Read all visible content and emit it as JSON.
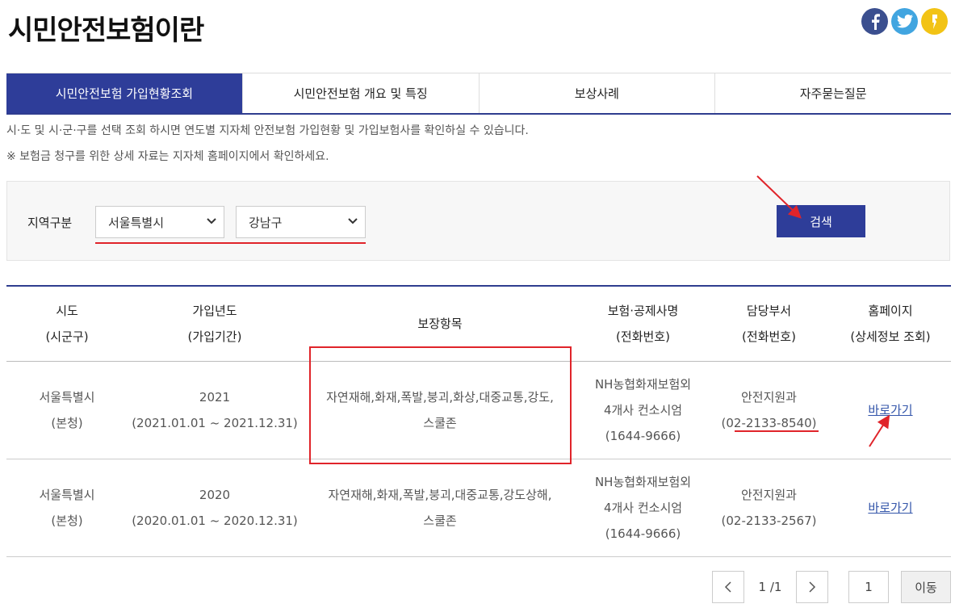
{
  "page": {
    "title": "시민안전보험이란"
  },
  "sns": [
    {
      "name": "facebook",
      "glyph": "f",
      "color": "#3b4f8f"
    },
    {
      "name": "twitter",
      "glyph": "t",
      "color": "#41a5e0"
    },
    {
      "name": "kakaostory",
      "glyph": "s",
      "color": "#f2c315"
    }
  ],
  "tabs": [
    {
      "label": "시민안전보험 가입현황조회",
      "active": true
    },
    {
      "label": "시민안전보험 개요 및 특징"
    },
    {
      "label": "보상사례"
    },
    {
      "label": "자주묻는질문"
    }
  ],
  "notices": [
    "시·도 및 시·군·구를 선택 조회 하시면 연도별 지자체 안전보험 가입현황 및 가입보험사를 확인하실 수 있습니다.",
    "※ 보험금 청구를 위한 상세 자료는 지자체 홈페이지에서 확인하세요."
  ],
  "search": {
    "label": "지역구분",
    "sido": "서울특별시",
    "sigungu": "강남구",
    "button": "검색"
  },
  "table": {
    "headers": [
      [
        "시도",
        "(시군구)"
      ],
      [
        "가입년도",
        "(가입기간)"
      ],
      [
        "보장항목"
      ],
      [
        "보험·공제사명",
        "(전화번호)"
      ],
      [
        "담당부서",
        "(전화번호)"
      ],
      [
        "홈페이지",
        "(상세정보 조회)"
      ]
    ],
    "rows": [
      {
        "sido": [
          "서울특별시",
          "(본청)"
        ],
        "year": [
          "2021",
          "(2021.01.01 ~ 2021.12.31)"
        ],
        "coverage": [
          "자연재해,화재,폭발,붕괴,화상,대중교통,강도,",
          "스쿨존"
        ],
        "insurer": [
          "NH농협화재보험외",
          "4개사 컨소시엄",
          "(1644-9666)"
        ],
        "dept": [
          "안전지원과",
          "(02-2133-8540)"
        ],
        "link": "바로가기"
      },
      {
        "sido": [
          "서울특별시",
          "(본청)"
        ],
        "year": [
          "2020",
          "(2020.01.01 ~ 2020.12.31)"
        ],
        "coverage": [
          "자연재해,화재,폭발,붕괴,대중교통,강도상해,",
          "스쿨존"
        ],
        "insurer": [
          "NH농협화재보험외",
          "4개사 컨소시엄",
          "(1644-9666)"
        ],
        "dept": [
          "안전지원과",
          "(02-2133-2567)"
        ],
        "link": "바로가기"
      }
    ]
  },
  "pagination": {
    "prev": "‹",
    "status": "1 /1",
    "next": "›",
    "page_input": "1",
    "go": "이동"
  },
  "colors": {
    "primary": "#2e3d99",
    "annotation": "#e0242a"
  }
}
